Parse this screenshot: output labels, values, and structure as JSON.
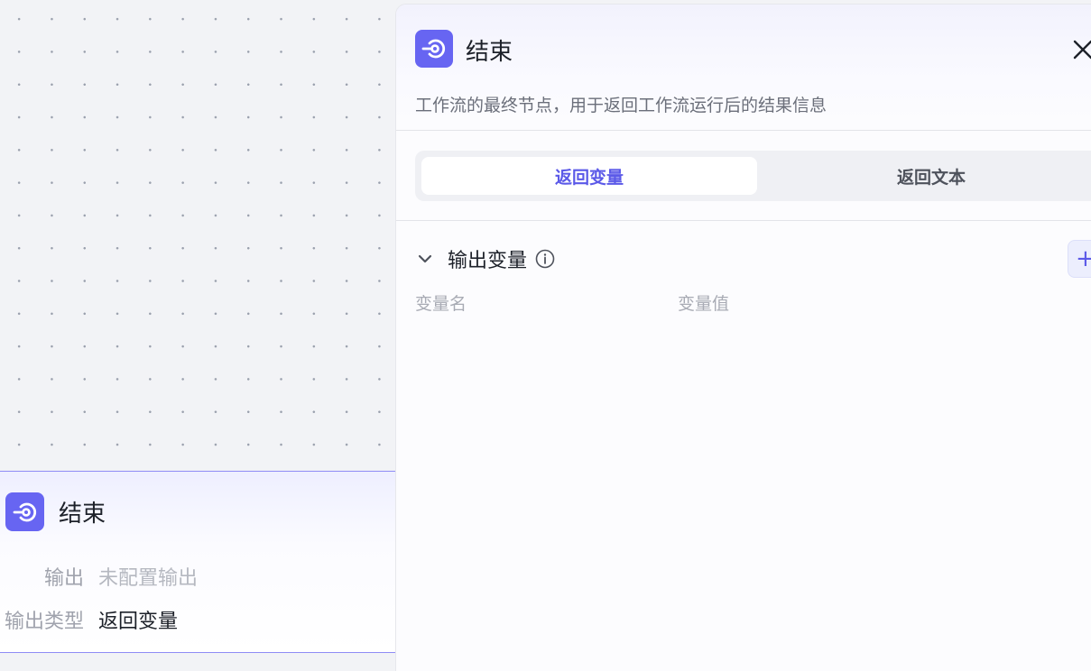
{
  "colors": {
    "accent": "#6765f2",
    "active_tab_text": "#5b59e8",
    "node_border": "#8f8cf5"
  },
  "node": {
    "icon": "end-node-icon",
    "title": "结束",
    "output_label": "输出",
    "output_value": "未配置输出",
    "type_label": "输出类型",
    "type_value": "返回变量"
  },
  "panel": {
    "icon": "end-node-icon",
    "title": "结束",
    "description": "工作流的最终节点，用于返回工作流运行后的结果信息",
    "close_icon": "close-icon",
    "tabs": [
      {
        "label": "返回变量",
        "active": true
      },
      {
        "label": "返回文本",
        "active": false
      }
    ],
    "section": {
      "title": "输出变量",
      "add_label": "+",
      "columns": [
        "变量名",
        "变量值"
      ]
    }
  }
}
